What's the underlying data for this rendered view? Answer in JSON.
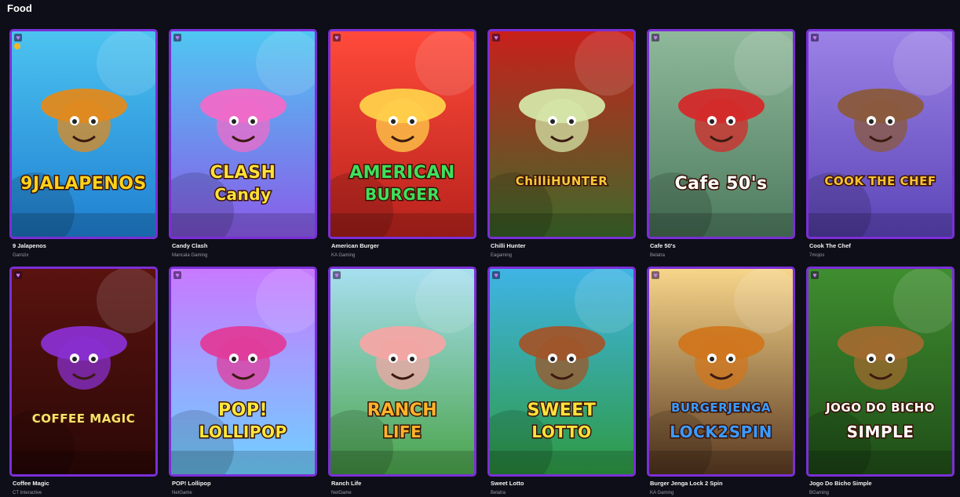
{
  "section": {
    "title": "Food"
  },
  "games": [
    {
      "name": "9 Jalapenos",
      "provider": "Gamzix",
      "logo": "9JALAPENOS",
      "logo_color": "#ffd21a",
      "bg_top": "#4cc3f0",
      "bg_bottom": "#1f7fd1",
      "accent": "#e08a1e"
    },
    {
      "name": "Candy Clash",
      "provider": "Mancala Gaming",
      "logo": "CLASH",
      "logo2": "Candy",
      "logo_color": "#ffe23a",
      "bg_top": "#4fc7f2",
      "bg_bottom": "#8a5ae8",
      "accent": "#f06bc8"
    },
    {
      "name": "American Burger",
      "provider": "KA Gaming",
      "logo": "AMERICAN",
      "logo2": "BURGER",
      "logo_color": "#3ee05c",
      "bg_top": "#ff4a3a",
      "bg_bottom": "#b7221c",
      "accent": "#ffcf4a"
    },
    {
      "name": "Chilli Hunter",
      "provider": "Eagaming",
      "logo": "ChilliHUNTER",
      "logo_color": "#f7c93a",
      "bg_top": "#c9201c",
      "bg_bottom": "#3c6b2a",
      "accent": "#d4e6a8"
    },
    {
      "name": "Cafe 50's",
      "provider": "Belatra",
      "logo": "Cafe 50's",
      "logo_color": "#ffffff",
      "bg_top": "#8fb99a",
      "bg_bottom": "#4d7a5e",
      "accent": "#d42a2a"
    },
    {
      "name": "Cook The Chef",
      "provider": "7mojos",
      "logo": "COOK THE CHEF",
      "logo_color": "#f6c232",
      "bg_top": "#9b82e6",
      "bg_bottom": "#5b44b7",
      "accent": "#8a5a3c"
    },
    {
      "name": "Coffee Magic",
      "provider": "CT Interactive",
      "logo": "COFFEE MAGIC",
      "logo_color": "#fbe36a",
      "bg_top": "#5a130f",
      "bg_bottom": "#2a0806",
      "accent": "#8a2fd0"
    },
    {
      "name": "POP! Lollipop",
      "provider": "NetGame",
      "logo": "POP!",
      "logo2": "LOLLIPOP",
      "logo_color": "#ffe83a",
      "bg_top": "#c879ff",
      "bg_bottom": "#6fd0ff",
      "accent": "#e03b9b"
    },
    {
      "name": "Ranch Life",
      "provider": "NetGame",
      "logo": "RANCH",
      "logo2": "LIFE",
      "logo_color": "#ffb42a",
      "bg_top": "#a7dff0",
      "bg_bottom": "#4aa44a",
      "accent": "#f3a6a4"
    },
    {
      "name": "Sweet Lotto",
      "provider": "Belatra",
      "logo": "SWEET",
      "logo2": "LOTTO",
      "logo_color": "#ffe23a",
      "bg_top": "#3fb4e6",
      "bg_bottom": "#2e9a42",
      "accent": "#a0552a"
    },
    {
      "name": "Burger Jenga Lock 2 Spin",
      "provider": "KA Gaming",
      "logo": "BURGERJENGA",
      "logo2": "LOCK2SPIN",
      "logo_color": "#3a9bff",
      "bg_top": "#f7d58a",
      "bg_bottom": "#5a3a22",
      "accent": "#d0761e"
    },
    {
      "name": "Jogo Do Bicho Simple",
      "provider": "BGaming",
      "logo": "JOGO DO BICHO",
      "logo2": "SIMPLE",
      "logo_color": "#ffffff",
      "bg_top": "#3f8e30",
      "bg_bottom": "#1f4d18",
      "accent": "#a06a2e"
    }
  ]
}
